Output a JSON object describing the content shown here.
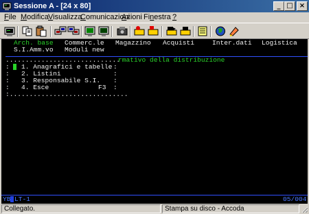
{
  "window": {
    "title": "Sessione A - [24 x 80]",
    "controls": {
      "minimize": "_",
      "maximize": "□",
      "close": "×"
    }
  },
  "menu": [
    {
      "label": "File",
      "key": "F",
      "rest": "ile"
    },
    {
      "label": "Modifica",
      "key": "M",
      "rest": "odifica"
    },
    {
      "label": "Visualizza",
      "key": "V",
      "rest": "isualizza"
    },
    {
      "label": "Comunicazioni",
      "key": "C",
      "rest": "omunicazioni"
    },
    {
      "label": "Azioni",
      "key": "A",
      "rest": "zioni"
    },
    {
      "label": "Finestra",
      "key": "n",
      "pre": "Fi",
      "rest": "estra"
    },
    {
      "label": "?",
      "key": "?",
      "rest": ""
    }
  ],
  "toolbar": {
    "icons": [
      "print-screen-icon",
      "copy-icon",
      "paste-icon",
      "send-file-icon",
      "receive-file-icon",
      "display-setup-icon",
      "macro-icon",
      "record-macro-icon",
      "stop-macro-icon",
      "play-macro-icon",
      "keyboard-map-icon",
      "clipboard-icon",
      "globe-icon",
      "help-icon"
    ]
  },
  "terminal": {
    "menu_row1": [
      "Arch. base",
      "Commerc.le",
      "Magazzino",
      "Acquisti",
      "Inter.dati",
      "Logistica"
    ],
    "menu_row2": [
      "S.I.Amm.vo",
      "Moduli new"
    ],
    "popup_title_tail": "rmativo della distribuzione",
    "popup_items": [
      {
        "num": "1.",
        "label": "Anagrafici e tabelle"
      },
      {
        "num": "2.",
        "label": "Listini"
      },
      {
        "num": "3.",
        "label": "Responsabile S.I."
      },
      {
        "num": "4.",
        "label": "Esce"
      }
    ],
    "esce_key": "F3",
    "oia_left": "YB",
    "oia_mid": "LT-1",
    "oia_right": "05/004"
  },
  "status": {
    "left": "Collegato.",
    "right": "Stampa su disco - Accoda"
  }
}
